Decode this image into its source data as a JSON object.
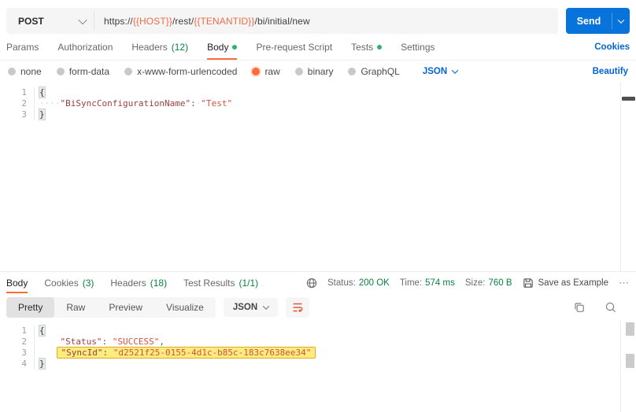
{
  "request_bar": {
    "method": "POST",
    "url": {
      "scheme": "https://",
      "host_var": "{{HOST}}",
      "path_rest": "/rest/",
      "tenant_var": "{{TENANTID}}",
      "path_tail": "/bi/initial/new"
    },
    "send_label": "Send"
  },
  "request_tabs": {
    "items": [
      {
        "label": "Params"
      },
      {
        "label": "Authorization"
      },
      {
        "label": "Headers",
        "count": "(12)"
      },
      {
        "label": "Body",
        "dot": true,
        "active": true
      },
      {
        "label": "Pre-request Script"
      },
      {
        "label": "Tests",
        "dot": true
      },
      {
        "label": "Settings"
      }
    ],
    "cookies_link": "Cookies"
  },
  "body_type_bar": {
    "options": [
      {
        "label": "none"
      },
      {
        "label": "form-data"
      },
      {
        "label": "x-www-form-urlencoded"
      },
      {
        "label": "raw",
        "selected": true
      },
      {
        "label": "binary"
      },
      {
        "label": "GraphQL"
      }
    ],
    "format_select": "JSON",
    "beautify_link": "Beautify"
  },
  "request_editor": {
    "lines": [
      {
        "num": "1",
        "tokens": [
          {
            "text": "{",
            "type": "brace"
          }
        ]
      },
      {
        "num": "2",
        "tokens": [
          {
            "text": "····",
            "type": "ws"
          },
          {
            "text": "\"BiSyncConfigurationName\"",
            "type": "key"
          },
          {
            "text": ":",
            "type": "punct"
          },
          {
            "text": "·",
            "type": "ws"
          },
          {
            "text": "\"Test\"",
            "type": "str"
          }
        ]
      },
      {
        "num": "3",
        "tokens": [
          {
            "text": "}",
            "type": "brace"
          }
        ]
      }
    ]
  },
  "response_header": {
    "tabs": [
      {
        "label": "Body",
        "active": true
      },
      {
        "label": "Cookies",
        "count": "(3)"
      },
      {
        "label": "Headers",
        "count": "(18)"
      },
      {
        "label": "Test Results",
        "count": "(1/1)"
      }
    ],
    "status_label": "Status:",
    "status_value": "200 OK",
    "time_label": "Time:",
    "time_value": "574 ms",
    "size_label": "Size:",
    "size_value": "760 B",
    "save_as_example": "Save as Example",
    "more_icon": "⋯"
  },
  "response_toolbar": {
    "views": [
      {
        "label": "Pretty",
        "active": true
      },
      {
        "label": "Raw"
      },
      {
        "label": "Preview"
      },
      {
        "label": "Visualize"
      }
    ],
    "format_select": "JSON"
  },
  "response_editor": {
    "lines": [
      {
        "num": "1",
        "tokens": [
          {
            "text": "{",
            "type": "brace"
          }
        ]
      },
      {
        "num": "2",
        "tokens": [
          {
            "text": "    ",
            "type": "ws"
          },
          {
            "text": "\"Status\"",
            "type": "key"
          },
          {
            "text": ": ",
            "type": "punct"
          },
          {
            "text": "\"SUCCESS\"",
            "type": "str"
          },
          {
            "text": ",",
            "type": "punct"
          }
        ]
      },
      {
        "num": "3",
        "highlight": true,
        "tokens": [
          {
            "text": "    ",
            "type": "ws"
          },
          {
            "text": "\"SyncId\"",
            "type": "key"
          },
          {
            "text": ": ",
            "type": "punct"
          },
          {
            "text": "\"d2521f25-0155-4d1c-b85c-183c7638ee34\"",
            "type": "str"
          }
        ]
      },
      {
        "num": "4",
        "tokens": [
          {
            "text": "}",
            "type": "brace"
          }
        ]
      }
    ]
  },
  "colors": {
    "accent_orange": "#ff6c37",
    "link_blue": "#0265d2",
    "send_blue": "#0873da",
    "success_green": "#0a8240",
    "highlight_yellow": "#ffec80",
    "highlight_border": "#e5a819"
  }
}
